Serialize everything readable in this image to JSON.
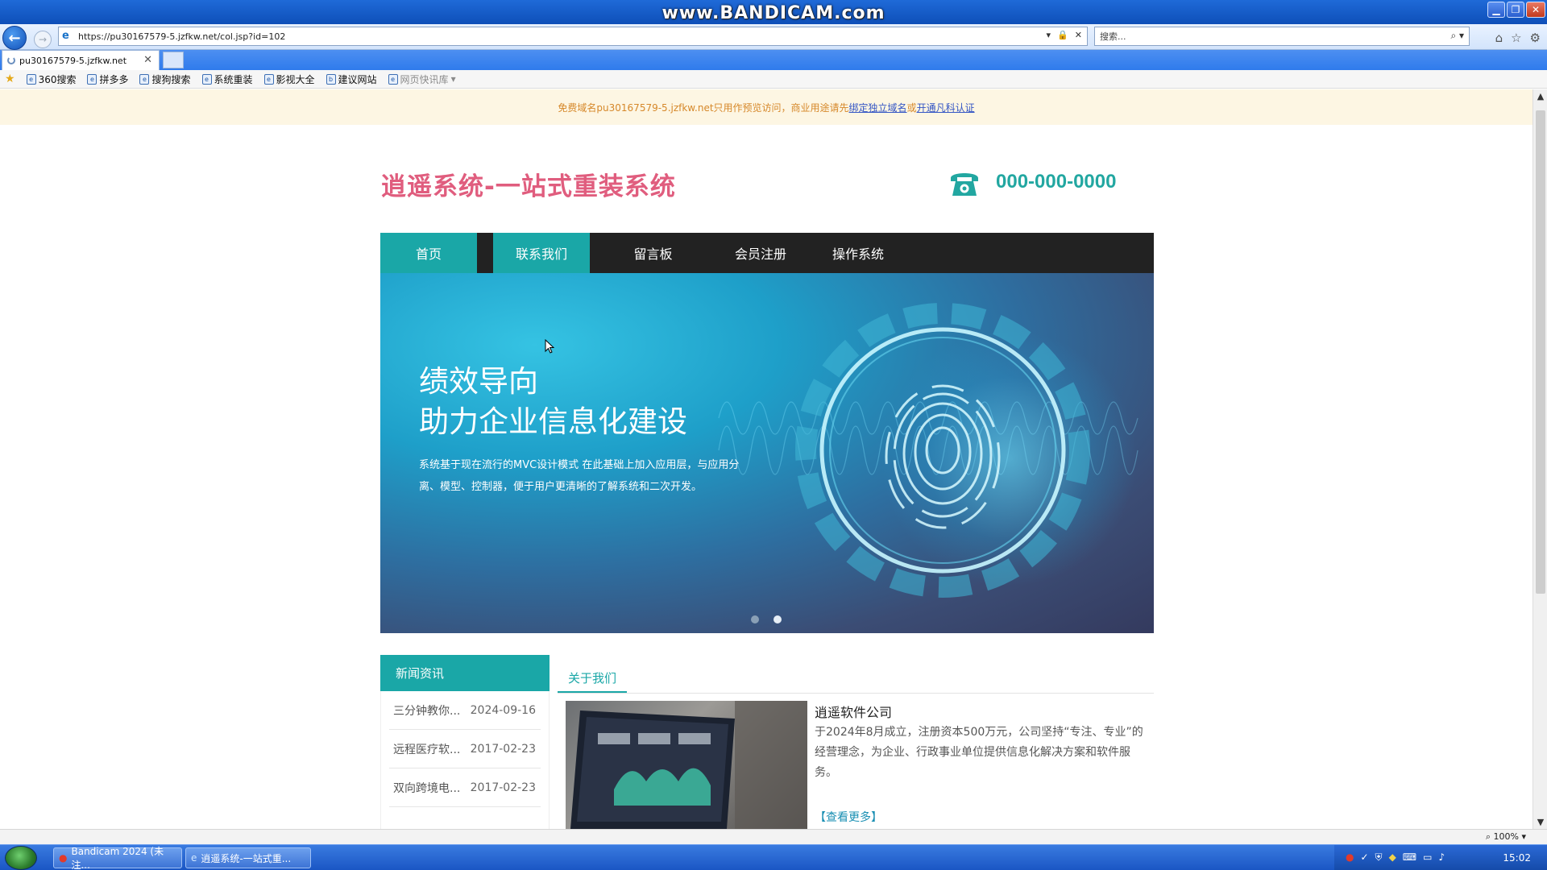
{
  "browser": {
    "watermark": "www.BANDICAM.com",
    "url": "https://pu30167579-5.jzfkw.net/col.jsp?id=102",
    "search_placeholder": "搜索...",
    "tab_title": "pu30167579-5.jzfkw.net",
    "favorites": [
      "360搜索",
      "拼多多",
      "搜狗搜索",
      "系统重装",
      "影视大全",
      "建议网站",
      "网页快讯库"
    ],
    "zoom": "100%"
  },
  "notice": {
    "text": "免费域名pu30167579-5.jzfkw.net只用作预览访问，商业用途请先",
    "link1": "绑定独立域名",
    "sep": "或",
    "link2": "开通凡科认证"
  },
  "site": {
    "logo": "逍遥系统-一站式重装系统",
    "phone": "000-000-0000",
    "nav": [
      "首页",
      "联系我们",
      "留言板",
      "会员注册",
      "操作系统"
    ],
    "banner": {
      "line1": "绩效导向",
      "line2": "助力企业信息化建设",
      "desc": "系统基于现在流行的MVC设计模式 在此基础上加入应用层，与应用分离、模型、控制器，便于用户更清晰的了解系统和二次开发。"
    },
    "news": {
      "heading": "新闻资讯",
      "items": [
        {
          "title": "三分钟教你...",
          "date": "2024-09-16"
        },
        {
          "title": "远程医疗软...",
          "date": "2017-02-23"
        },
        {
          "title": "双向跨境电...",
          "date": "2017-02-23"
        }
      ]
    },
    "about": {
      "tab": "关于我们",
      "company": "逍遥软件公司",
      "intro": "于2024年8月成立，注册资本500万元，公司坚持“专注、专业”的经营理念，为企业、行政事业单位提供信息化解决方案和软件服务。",
      "more": "【查看更多】"
    }
  },
  "taskbar": {
    "tasks": [
      "Bandicam 2024 (未注...",
      "逍遥系统-一站式重..."
    ],
    "clock": "15:02"
  },
  "colors": {
    "accent": "#1aa7a7",
    "logo": "#e05d7e",
    "nav_bg": "#222222"
  }
}
